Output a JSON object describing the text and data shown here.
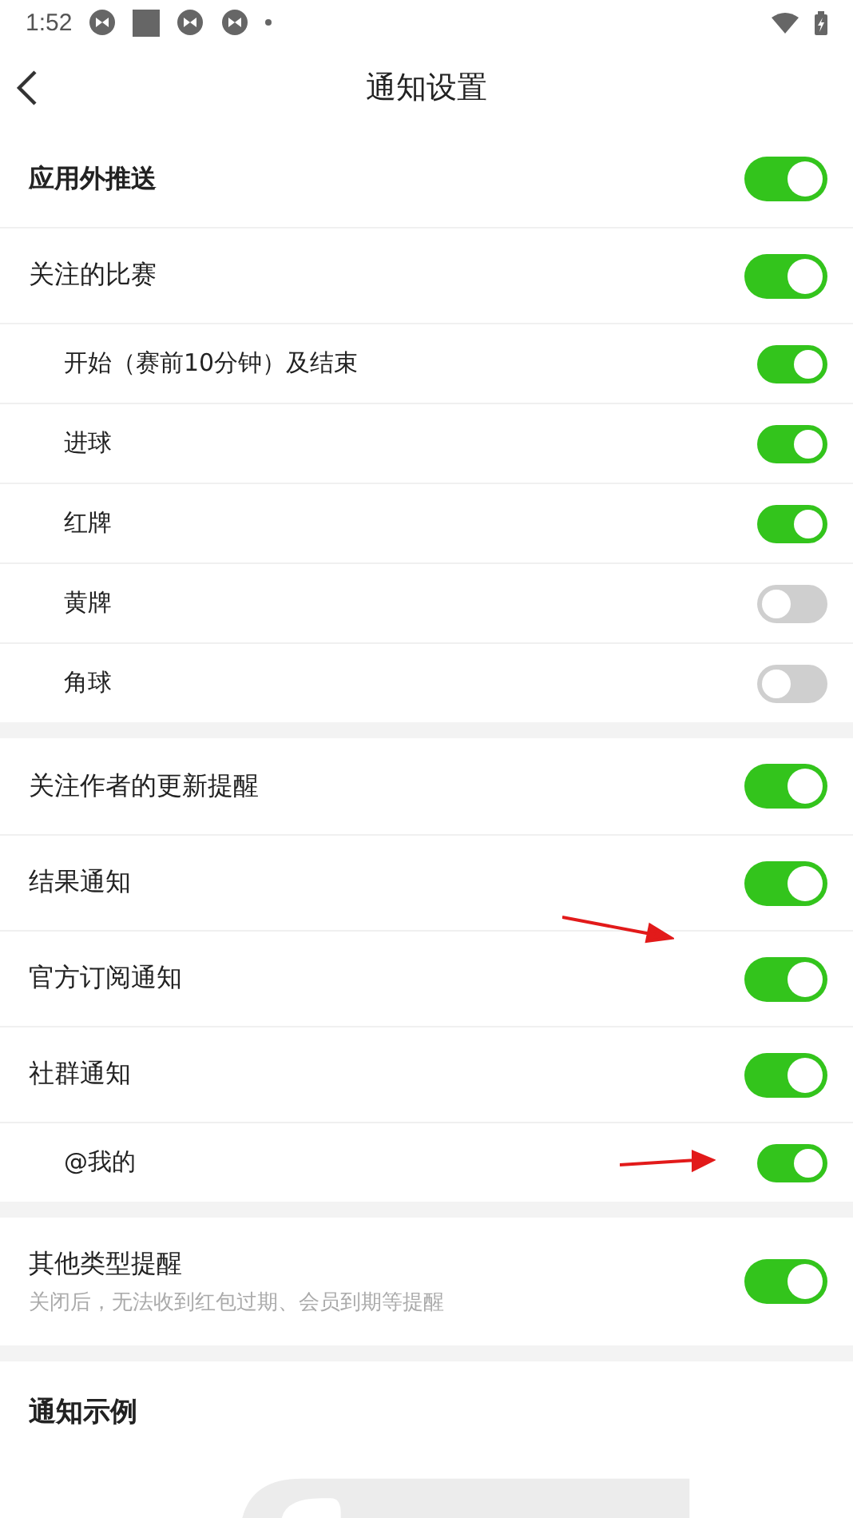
{
  "status_bar": {
    "time": "1:52"
  },
  "header": {
    "title": "通知设置"
  },
  "sections": [
    {
      "rows": [
        {
          "label": "应用外推送",
          "kind": "main",
          "on": true,
          "marked": false
        },
        {
          "label": "关注的比赛",
          "kind": "row",
          "on": true,
          "marked": false
        },
        {
          "label": "开始（赛前10分钟）及结束",
          "kind": "sub",
          "on": true,
          "marked": false
        },
        {
          "label": "进球",
          "kind": "sub",
          "on": true,
          "marked": false
        },
        {
          "label": "红牌",
          "kind": "sub",
          "on": true,
          "marked": false
        },
        {
          "label": "黄牌",
          "kind": "sub",
          "on": false,
          "marked": false
        },
        {
          "label": "角球",
          "kind": "sub",
          "on": false,
          "marked": false
        }
      ]
    },
    {
      "rows": [
        {
          "label": "关注作者的更新提醒",
          "kind": "row",
          "on": true,
          "marked": false
        },
        {
          "label": "结果通知",
          "kind": "row",
          "on": true,
          "marked": false
        },
        {
          "label": "官方订阅通知",
          "kind": "row",
          "on": true,
          "marked": true
        },
        {
          "label": "社群通知",
          "kind": "row",
          "on": true,
          "marked": false
        },
        {
          "label": "@我的",
          "kind": "sub",
          "on": true,
          "marked": true
        }
      ]
    },
    {
      "rows": [
        {
          "label": "其他类型提醒",
          "kind": "row",
          "on": true,
          "marked": false,
          "hint": "关闭后，无法收到红包过期、会员到期等提醒"
        }
      ]
    }
  ],
  "example": {
    "title": "通知示例",
    "kind": "picture"
  }
}
